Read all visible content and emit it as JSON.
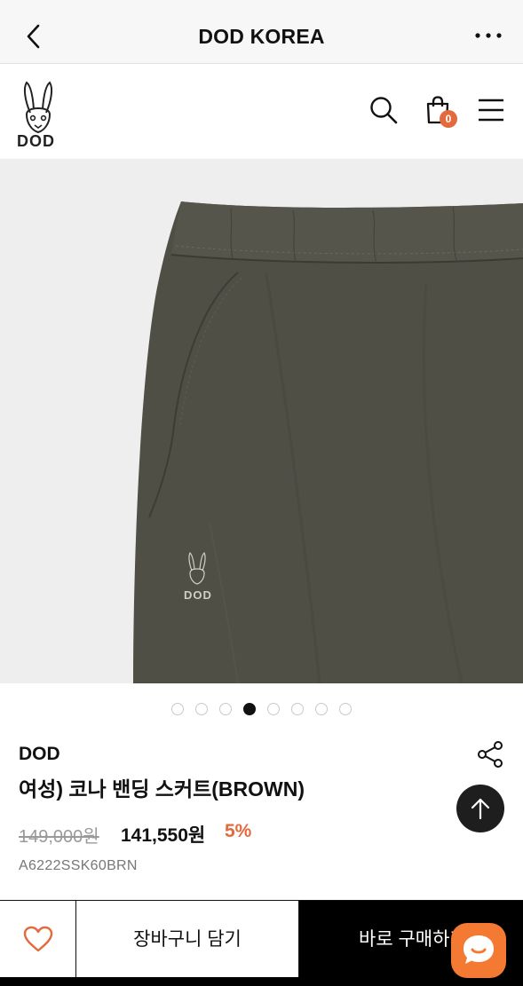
{
  "topbar": {
    "title": "DOD KOREA",
    "back_icon": "chevron-left-icon",
    "more_icon": "more-horizontal-icon"
  },
  "header": {
    "logo_text": "DOD",
    "cart_count": "0",
    "icons": [
      "search-icon",
      "shopping-bag-icon",
      "hamburger-menu-icon"
    ]
  },
  "gallery": {
    "total_images": 8,
    "active_index": 3,
    "embroidery_text": "DOD"
  },
  "product": {
    "brand": "DOD",
    "name": "여성) 코나 밴딩 스커트(BROWN)",
    "original_price": "149,000원",
    "sale_price": "141,550원",
    "discount": "5%",
    "sku": "A6222SSK60BRN"
  },
  "actions": {
    "cart_label": "장바구니 담기",
    "buy_label": "바로 구매하기"
  },
  "colors": {
    "accent": "#e26a3d",
    "chat": "#f47a34",
    "garment": "#4f4f46"
  }
}
